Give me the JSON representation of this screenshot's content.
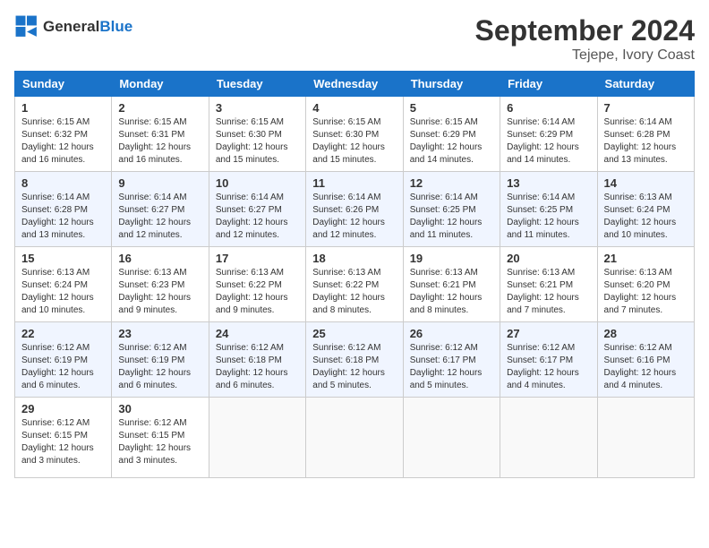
{
  "header": {
    "logo_general": "General",
    "logo_blue": "Blue",
    "month_year": "September 2024",
    "location": "Tejepe, Ivory Coast"
  },
  "days_of_week": [
    "Sunday",
    "Monday",
    "Tuesday",
    "Wednesday",
    "Thursday",
    "Friday",
    "Saturday"
  ],
  "weeks": [
    [
      {
        "day": "1",
        "sunrise": "Sunrise: 6:15 AM",
        "sunset": "Sunset: 6:32 PM",
        "daylight": "Daylight: 12 hours and 16 minutes."
      },
      {
        "day": "2",
        "sunrise": "Sunrise: 6:15 AM",
        "sunset": "Sunset: 6:31 PM",
        "daylight": "Daylight: 12 hours and 16 minutes."
      },
      {
        "day": "3",
        "sunrise": "Sunrise: 6:15 AM",
        "sunset": "Sunset: 6:30 PM",
        "daylight": "Daylight: 12 hours and 15 minutes."
      },
      {
        "day": "4",
        "sunrise": "Sunrise: 6:15 AM",
        "sunset": "Sunset: 6:30 PM",
        "daylight": "Daylight: 12 hours and 15 minutes."
      },
      {
        "day": "5",
        "sunrise": "Sunrise: 6:15 AM",
        "sunset": "Sunset: 6:29 PM",
        "daylight": "Daylight: 12 hours and 14 minutes."
      },
      {
        "day": "6",
        "sunrise": "Sunrise: 6:14 AM",
        "sunset": "Sunset: 6:29 PM",
        "daylight": "Daylight: 12 hours and 14 minutes."
      },
      {
        "day": "7",
        "sunrise": "Sunrise: 6:14 AM",
        "sunset": "Sunset: 6:28 PM",
        "daylight": "Daylight: 12 hours and 13 minutes."
      }
    ],
    [
      {
        "day": "8",
        "sunrise": "Sunrise: 6:14 AM",
        "sunset": "Sunset: 6:28 PM",
        "daylight": "Daylight: 12 hours and 13 minutes."
      },
      {
        "day": "9",
        "sunrise": "Sunrise: 6:14 AM",
        "sunset": "Sunset: 6:27 PM",
        "daylight": "Daylight: 12 hours and 12 minutes."
      },
      {
        "day": "10",
        "sunrise": "Sunrise: 6:14 AM",
        "sunset": "Sunset: 6:27 PM",
        "daylight": "Daylight: 12 hours and 12 minutes."
      },
      {
        "day": "11",
        "sunrise": "Sunrise: 6:14 AM",
        "sunset": "Sunset: 6:26 PM",
        "daylight": "Daylight: 12 hours and 12 minutes."
      },
      {
        "day": "12",
        "sunrise": "Sunrise: 6:14 AM",
        "sunset": "Sunset: 6:25 PM",
        "daylight": "Daylight: 12 hours and 11 minutes."
      },
      {
        "day": "13",
        "sunrise": "Sunrise: 6:14 AM",
        "sunset": "Sunset: 6:25 PM",
        "daylight": "Daylight: 12 hours and 11 minutes."
      },
      {
        "day": "14",
        "sunrise": "Sunrise: 6:13 AM",
        "sunset": "Sunset: 6:24 PM",
        "daylight": "Daylight: 12 hours and 10 minutes."
      }
    ],
    [
      {
        "day": "15",
        "sunrise": "Sunrise: 6:13 AM",
        "sunset": "Sunset: 6:24 PM",
        "daylight": "Daylight: 12 hours and 10 minutes."
      },
      {
        "day": "16",
        "sunrise": "Sunrise: 6:13 AM",
        "sunset": "Sunset: 6:23 PM",
        "daylight": "Daylight: 12 hours and 9 minutes."
      },
      {
        "day": "17",
        "sunrise": "Sunrise: 6:13 AM",
        "sunset": "Sunset: 6:22 PM",
        "daylight": "Daylight: 12 hours and 9 minutes."
      },
      {
        "day": "18",
        "sunrise": "Sunrise: 6:13 AM",
        "sunset": "Sunset: 6:22 PM",
        "daylight": "Daylight: 12 hours and 8 minutes."
      },
      {
        "day": "19",
        "sunrise": "Sunrise: 6:13 AM",
        "sunset": "Sunset: 6:21 PM",
        "daylight": "Daylight: 12 hours and 8 minutes."
      },
      {
        "day": "20",
        "sunrise": "Sunrise: 6:13 AM",
        "sunset": "Sunset: 6:21 PM",
        "daylight": "Daylight: 12 hours and 7 minutes."
      },
      {
        "day": "21",
        "sunrise": "Sunrise: 6:13 AM",
        "sunset": "Sunset: 6:20 PM",
        "daylight": "Daylight: 12 hours and 7 minutes."
      }
    ],
    [
      {
        "day": "22",
        "sunrise": "Sunrise: 6:12 AM",
        "sunset": "Sunset: 6:19 PM",
        "daylight": "Daylight: 12 hours and 6 minutes."
      },
      {
        "day": "23",
        "sunrise": "Sunrise: 6:12 AM",
        "sunset": "Sunset: 6:19 PM",
        "daylight": "Daylight: 12 hours and 6 minutes."
      },
      {
        "day": "24",
        "sunrise": "Sunrise: 6:12 AM",
        "sunset": "Sunset: 6:18 PM",
        "daylight": "Daylight: 12 hours and 6 minutes."
      },
      {
        "day": "25",
        "sunrise": "Sunrise: 6:12 AM",
        "sunset": "Sunset: 6:18 PM",
        "daylight": "Daylight: 12 hours and 5 minutes."
      },
      {
        "day": "26",
        "sunrise": "Sunrise: 6:12 AM",
        "sunset": "Sunset: 6:17 PM",
        "daylight": "Daylight: 12 hours and 5 minutes."
      },
      {
        "day": "27",
        "sunrise": "Sunrise: 6:12 AM",
        "sunset": "Sunset: 6:17 PM",
        "daylight": "Daylight: 12 hours and 4 minutes."
      },
      {
        "day": "28",
        "sunrise": "Sunrise: 6:12 AM",
        "sunset": "Sunset: 6:16 PM",
        "daylight": "Daylight: 12 hours and 4 minutes."
      }
    ],
    [
      {
        "day": "29",
        "sunrise": "Sunrise: 6:12 AM",
        "sunset": "Sunset: 6:15 PM",
        "daylight": "Daylight: 12 hours and 3 minutes."
      },
      {
        "day": "30",
        "sunrise": "Sunrise: 6:12 AM",
        "sunset": "Sunset: 6:15 PM",
        "daylight": "Daylight: 12 hours and 3 minutes."
      },
      null,
      null,
      null,
      null,
      null
    ]
  ]
}
